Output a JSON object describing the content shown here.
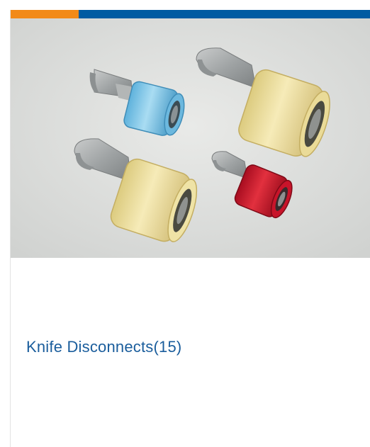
{
  "card": {
    "title": "Knife Disconnects",
    "count": "(15)",
    "accent_colors": {
      "orange": "#f28a18",
      "blue": "#005ba2"
    },
    "link_color": "#1a5d9c"
  },
  "image": {
    "subject": "knife-disconnect-terminals-photo",
    "terminal_colors": [
      "#8fc9e6",
      "#f1e2a0",
      "#efe3a6",
      "#c8142a"
    ]
  }
}
